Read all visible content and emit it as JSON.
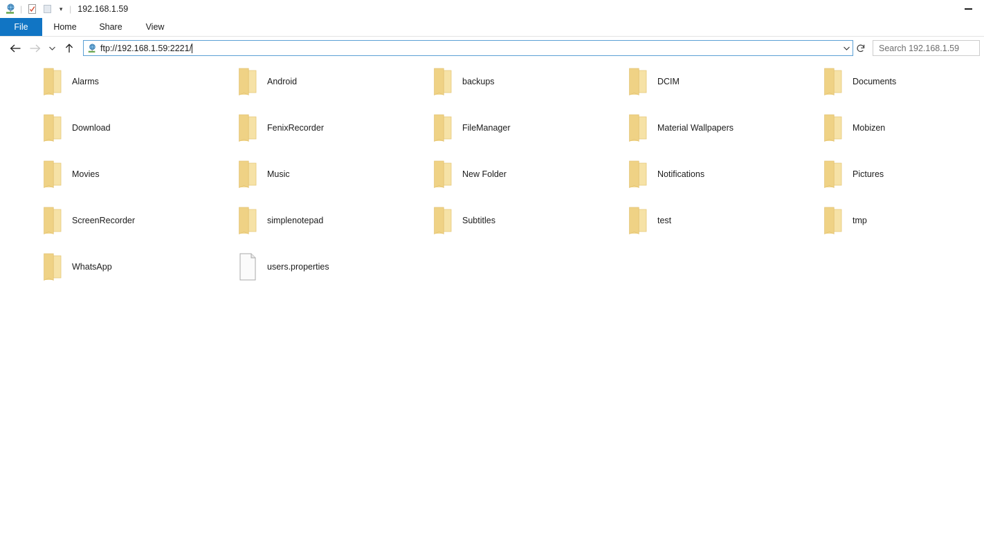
{
  "window": {
    "title": "192.168.1.59",
    "quick_access": [
      {
        "name": "ftp-site-icon",
        "label": "FTP site"
      },
      {
        "name": "properties-icon",
        "label": "Properties"
      },
      {
        "name": "new-folder-icon",
        "label": "New folder"
      },
      {
        "name": "customize-quick-access-chevron",
        "label": "Customize Quick Access Toolbar"
      }
    ],
    "controls": {
      "minimize": "Minimize"
    }
  },
  "ribbon": {
    "tabs": [
      {
        "label": "File",
        "active": true
      },
      {
        "label": "Home",
        "active": false
      },
      {
        "label": "Share",
        "active": false
      },
      {
        "label": "View",
        "active": false
      }
    ]
  },
  "navigation": {
    "back": "Back",
    "forward": "Forward",
    "recent": "Recent locations",
    "up": "Up",
    "address": {
      "value": "ftp://192.168.1.59:2221/",
      "icon": "ftp-site-icon",
      "dropdown": "Previous locations",
      "refresh": "Refresh"
    },
    "search": {
      "placeholder": "Search 192.168.1.59",
      "value": ""
    }
  },
  "content": {
    "items": [
      {
        "name": "Alarms",
        "type": "folder"
      },
      {
        "name": "Android",
        "type": "folder"
      },
      {
        "name": "backups",
        "type": "folder"
      },
      {
        "name": "DCIM",
        "type": "folder"
      },
      {
        "name": "Documents",
        "type": "folder"
      },
      {
        "name": "Download",
        "type": "folder"
      },
      {
        "name": "FenixRecorder",
        "type": "folder"
      },
      {
        "name": "FileManager",
        "type": "folder"
      },
      {
        "name": "Material Wallpapers",
        "type": "folder"
      },
      {
        "name": "Mobizen",
        "type": "folder"
      },
      {
        "name": "Movies",
        "type": "folder"
      },
      {
        "name": "Music",
        "type": "folder"
      },
      {
        "name": "New Folder",
        "type": "folder"
      },
      {
        "name": "Notifications",
        "type": "folder"
      },
      {
        "name": "Pictures",
        "type": "folder"
      },
      {
        "name": "ScreenRecorder",
        "type": "folder"
      },
      {
        "name": "simplenotepad",
        "type": "folder"
      },
      {
        "name": "Subtitles",
        "type": "folder"
      },
      {
        "name": "test",
        "type": "folder"
      },
      {
        "name": "tmp",
        "type": "folder"
      },
      {
        "name": "WhatsApp",
        "type": "folder"
      },
      {
        "name": "users.properties",
        "type": "file"
      }
    ]
  },
  "colors": {
    "accent": "#1175c4",
    "folder": "#f2d88f",
    "folder_edge": "#e8c96f",
    "address_border": "#5a9fd4",
    "text": "#1b1b1b",
    "placeholder": "#6d6d6d"
  }
}
